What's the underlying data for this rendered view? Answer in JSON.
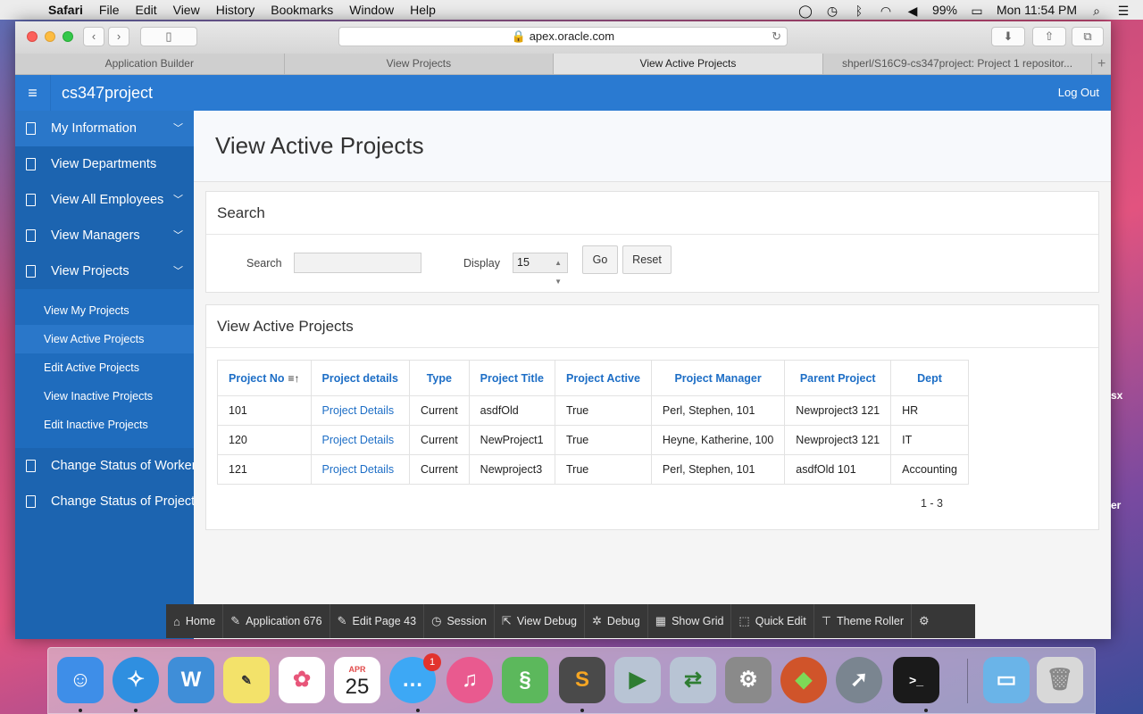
{
  "menubar": {
    "app": "Safari",
    "items": [
      "File",
      "Edit",
      "View",
      "History",
      "Bookmarks",
      "Window",
      "Help"
    ],
    "battery": "99%",
    "clock": "Mon 11:54 PM"
  },
  "browser": {
    "url": "apex.oracle.com",
    "tabs": [
      {
        "label": "Application Builder"
      },
      {
        "label": "View Projects"
      },
      {
        "label": "View Active Projects"
      },
      {
        "label": "shperl/S16C9-cs347project: Project 1 repositor..."
      }
    ]
  },
  "header": {
    "app_title": "cs347project",
    "logout": "Log Out"
  },
  "sidebar": {
    "items": [
      {
        "label": "My Information"
      },
      {
        "label": "View Departments"
      },
      {
        "label": "View All Employees"
      },
      {
        "label": "View Managers"
      },
      {
        "label": "View Projects"
      }
    ],
    "sub_items": [
      {
        "label": "View My Projects"
      },
      {
        "label": "View Active Projects"
      },
      {
        "label": "Edit Active Projects"
      },
      {
        "label": "View Inactive Projects"
      },
      {
        "label": "Edit Inactive Projects"
      }
    ],
    "bottom_items": [
      {
        "label": "Change Status of Worker"
      },
      {
        "label": "Change Status of Project"
      }
    ]
  },
  "page": {
    "title": "View Active Projects"
  },
  "search_region": {
    "title": "Search",
    "search_label": "Search",
    "search_value": "",
    "display_label": "Display",
    "display_value": "15",
    "go_label": "Go",
    "reset_label": "Reset"
  },
  "report": {
    "title": "View Active Projects",
    "columns": [
      "Project No",
      "Project details",
      "Type",
      "Project Title",
      "Project Active",
      "Project Manager",
      "Parent Project",
      "Dept"
    ],
    "rows": [
      [
        "101",
        "Project Details",
        "Current",
        "asdfOld",
        "True",
        "Perl, Stephen, 101",
        "Newproject3 121",
        "HR"
      ],
      [
        "120",
        "Project Details",
        "Current",
        "NewProject1",
        "True",
        "Heyne, Katherine, 100",
        "Newproject3 121",
        "IT"
      ],
      [
        "121",
        "Project Details",
        "Current",
        "Newproject3",
        "True",
        "Perl, Stephen, 101",
        "asdfOld 101",
        "Accounting"
      ]
    ],
    "pagination": "1 - 3"
  },
  "devbar": {
    "items": [
      "Home",
      "Application 676",
      "Edit Page 43",
      "Session",
      "View Debug",
      "Debug",
      "Show Grid",
      "Quick Edit",
      "Theme Roller"
    ]
  },
  "dock": {
    "calendar_month": "APR",
    "calendar_day": "25",
    "messages_badge": "1"
  },
  "colors": {
    "header": "#2a7ad1",
    "sidebar": "#1c64b0",
    "link": "#1d6ec6"
  }
}
